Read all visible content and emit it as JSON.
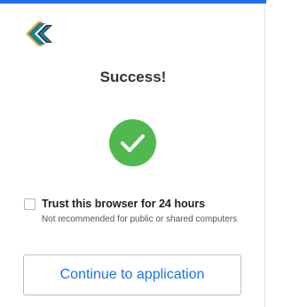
{
  "colors": {
    "top_bar": "#1a73e8",
    "logo_teal": "#1b7f8c",
    "logo_dark": "#1d2b3a",
    "logo_gold": "#e8a53a",
    "success_green": "#4fb94f",
    "button_text": "#1a73e8"
  },
  "icons": {
    "logo": "chevron-double-left-logo",
    "success": "check-icon"
  },
  "header": {
    "title": "Success!"
  },
  "trust": {
    "label": "Trust this browser for 24 hours",
    "note": "Not recommended for public or shared computers",
    "checked": false
  },
  "actions": {
    "continue_label": "Continue to application"
  }
}
